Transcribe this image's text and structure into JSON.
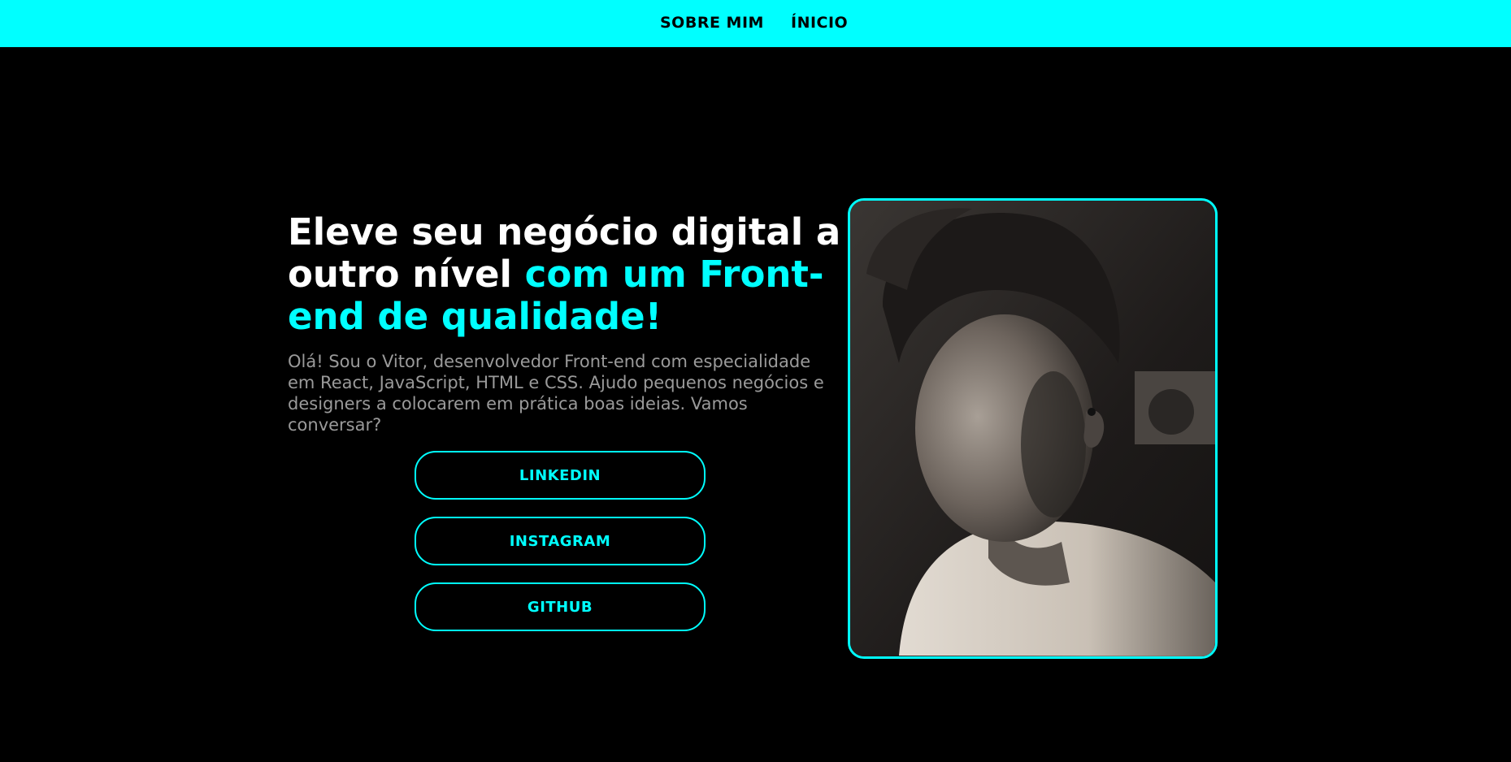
{
  "nav": {
    "items": [
      {
        "label": "SOBRE MIM"
      },
      {
        "label": "ÍNICIO"
      }
    ]
  },
  "hero": {
    "headline_part1": "Eleve seu negócio digital a outro nível ",
    "headline_accent": "com um Front-end de qualidade!",
    "intro": "Olá! Sou o Vitor, desenvolvedor Front-end com especialidade em React, JavaScript, HTML e CSS. Ajudo pequenos negócios e designers a colocarem em prática boas ideias. Vamos conversar?"
  },
  "buttons": {
    "linkedin": "LINKEDIN",
    "instagram": "INSTAGRAM",
    "github": "GITHUB"
  },
  "colors": {
    "accent": "#00ffff",
    "background": "#000000",
    "text": "#ffffff",
    "muted_text": "#9a9a9a"
  }
}
